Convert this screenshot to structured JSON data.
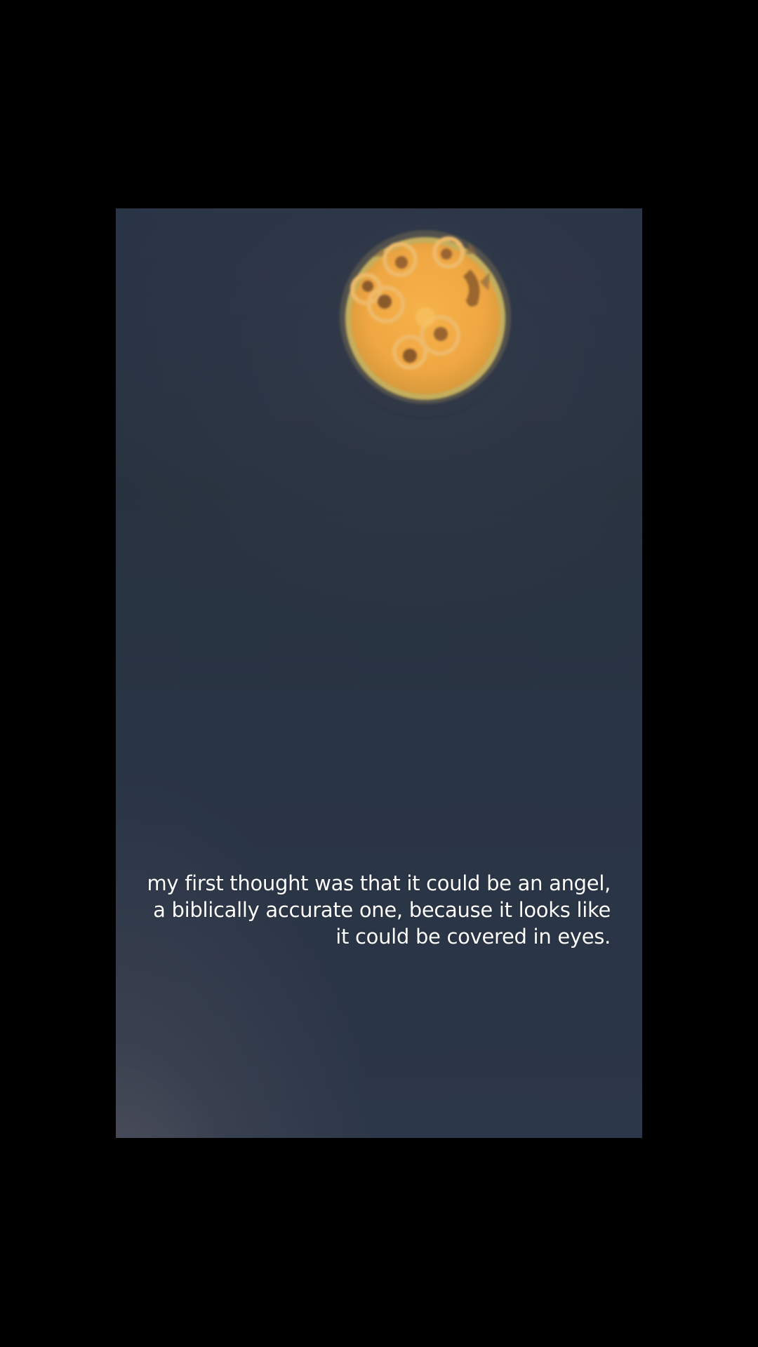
{
  "caption": {
    "lines": [
      "my first thought was that it could be an angel,",
      "a biblically accurate one, because it looks like",
      "it could be covered in eyes."
    ]
  },
  "colors": {
    "page_background": "#000000",
    "sky": "#2a3447",
    "orb_fill": "#f0a743",
    "orb_rim": "#d8c060",
    "ring_color": "#e8b868",
    "eye_color": "#8a5a2a",
    "caption_text": "#ffffff"
  }
}
